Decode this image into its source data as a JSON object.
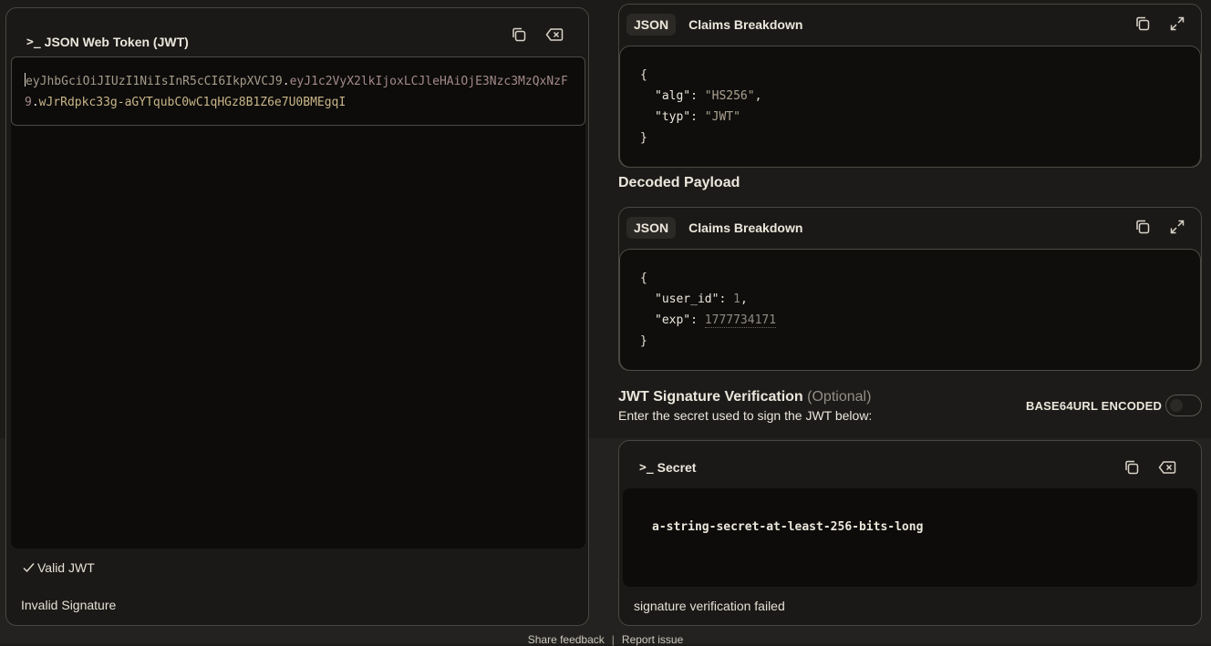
{
  "token_panel": {
    "title": "JSON Web Token (JWT)",
    "prompt_glyph": ">_",
    "token": {
      "header": "eyJhbGciOiJIUzI1NiIsInR5cCI6IkpXVCJ9",
      "payload": "eyJ1c2VyX2lkIjoxLCJleHAiOjE3Nzc3MzQxNzF9",
      "signature": "wJrRdpkc33g-aGYTqubC0wC1qHGz8B1Z6e7U0BMEgqI"
    },
    "status_valid": "Valid JWT",
    "status_signature": "Invalid Signature"
  },
  "header_panel": {
    "tabs": [
      "JSON",
      "Claims Breakdown"
    ],
    "json": {
      "open": "{",
      "close": "}",
      "alg_key": "\"alg\"",
      "alg_value": "\"HS256\"",
      "typ_key": "\"typ\"",
      "typ_value": "\"JWT\""
    }
  },
  "payload_panel": {
    "label": "Decoded Payload",
    "tabs": [
      "JSON",
      "Claims Breakdown"
    ],
    "json": {
      "open": "{",
      "close": "}",
      "user_id_key": "\"user_id\"",
      "user_id_value": "1",
      "exp_key": "\"exp\"",
      "exp_value": "1777734171"
    }
  },
  "verification": {
    "title": "JWT Signature Verification",
    "optional": "(Optional)",
    "subtitle": "Enter the secret used to sign the JWT below:",
    "base64_label": "BASE64URL ENCODED",
    "base64_enabled": false,
    "secret_title": "Secret",
    "secret_value": "a-string-secret-at-least-256-bits-long",
    "status": "signature verification failed"
  },
  "footer": {
    "share": "Share feedback",
    "separator": "|",
    "report": "Report issue"
  },
  "colors": {
    "background": "#1c1b19",
    "card": "#1a1917",
    "editor": "#0d0c0b",
    "token_header": "#a59b8a",
    "token_payload": "#a38a8a",
    "token_signature": "#c9b688"
  },
  "icons": {
    "copy": "copy-icon",
    "clear": "clear-icon",
    "expand": "expand-icon",
    "check": "check-icon",
    "terminal": "terminal-icon"
  }
}
